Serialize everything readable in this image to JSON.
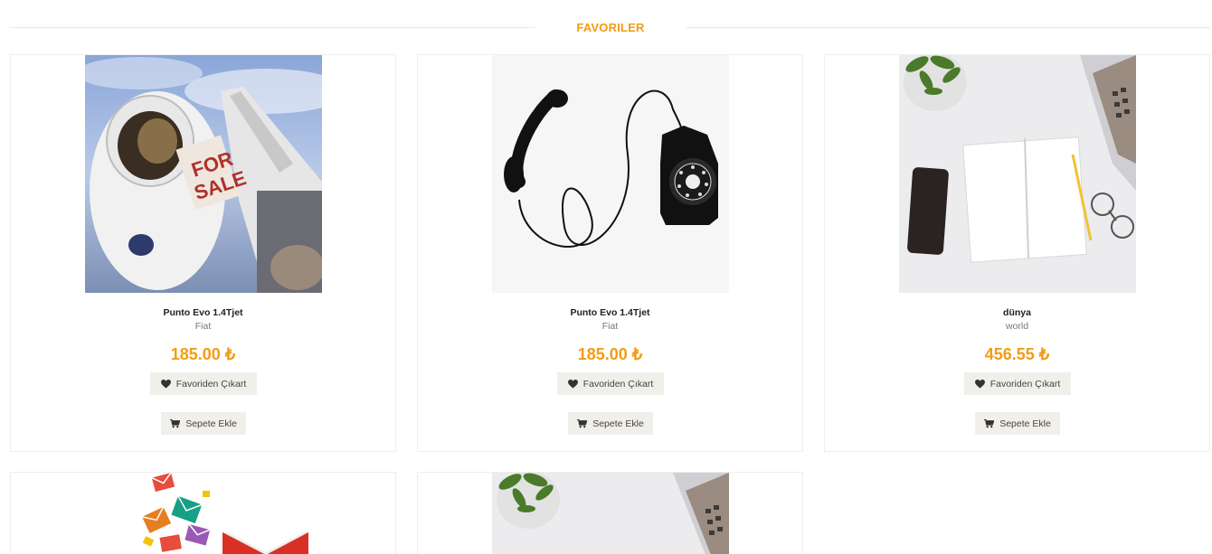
{
  "section": {
    "title": "FAVORILER"
  },
  "colors": {
    "accent": "#f39c12",
    "button_bg": "#f1efe9"
  },
  "products": [
    {
      "name": "Punto Evo 1.4Tjet",
      "brand": "Fiat",
      "price": "185.00 ₺",
      "fav_label": "Favoriden Çıkart",
      "cart_label": "Sepete Ekle",
      "image": "astronaut-for-sale"
    },
    {
      "name": "Punto Evo 1.4Tjet",
      "brand": "Fiat",
      "price": "185.00 ₺",
      "fav_label": "Favoriden Çıkart",
      "cart_label": "Sepete Ekle",
      "image": "black-rotary-telephone"
    },
    {
      "name": "dünya",
      "brand": "world",
      "price": "456.55 ₺",
      "fav_label": "Favoriden Çıkart",
      "cart_label": "Sepete Ekle",
      "image": "desk-notebook-phone-laptop"
    },
    {
      "image": "envelopes-mail"
    },
    {
      "image": "desk-plant-laptop"
    }
  ],
  "icons": {
    "heart": "heart-icon",
    "cart": "cart-icon"
  }
}
